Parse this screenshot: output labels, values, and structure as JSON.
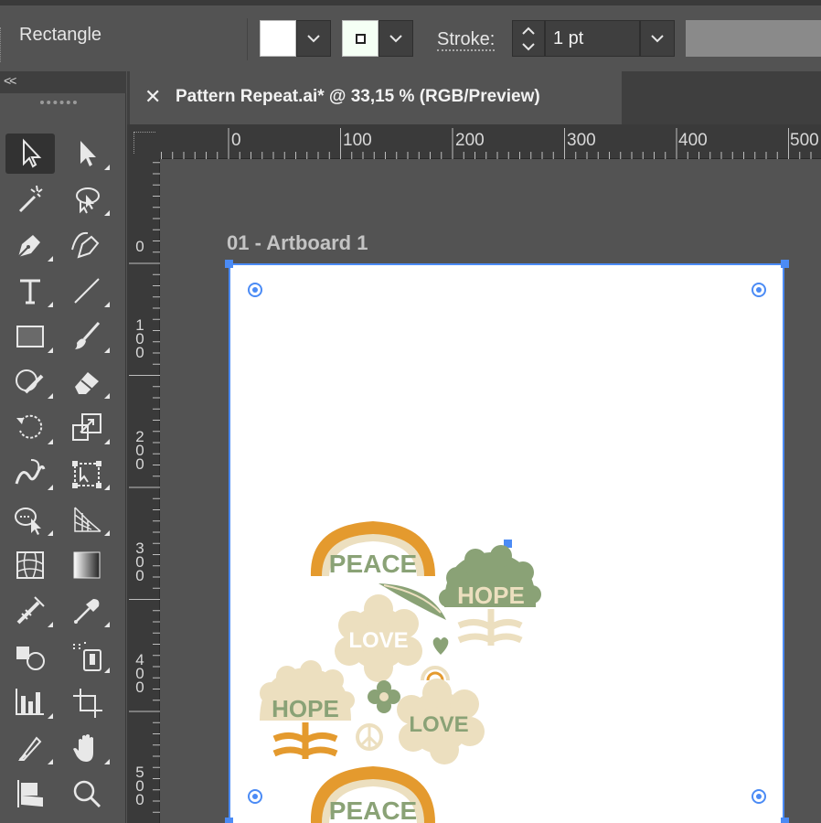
{
  "control_bar": {
    "selection_label": "Rectangle",
    "stroke_label": "Stroke:",
    "stroke_weight": "1 pt",
    "fill_color": "#ffffff"
  },
  "document": {
    "tab_close": "✕",
    "tab_title": "Pattern Repeat.ai* @ 33,15 % (RGB/Preview)"
  },
  "toolbar": {
    "collapse": "<<",
    "tools": [
      "selection-tool",
      "direct-selection-tool",
      "magic-wand-tool",
      "lasso-tool",
      "pen-tool",
      "curvature-tool",
      "type-tool",
      "line-segment-tool",
      "rectangle-tool",
      "paintbrush-tool",
      "shaper-tool",
      "eraser-tool",
      "rotate-tool",
      "scale-tool",
      "warp-tool",
      "free-transform-tool",
      "shape-builder-tool",
      "perspective-grid-tool",
      "mesh-tool",
      "gradient-tool",
      "eyedropper-tool",
      "measure-tool",
      "blend-tool",
      "symbol-sprayer-tool",
      "column-graph-tool",
      "artboard-tool",
      "slice-tool",
      "hand-tool",
      "toggle-tool",
      "zoom-tool"
    ]
  },
  "ruler": {
    "horizontal": [
      "0",
      "100",
      "200",
      "300",
      "400",
      "500"
    ],
    "vertical": [
      "0",
      "1\n0\n0",
      "2\n0\n0",
      "3\n0\n0",
      "4\n0\n0",
      "5\n0\n0"
    ]
  },
  "artboard": {
    "label": "01 - Artboard 1"
  },
  "artwork": {
    "words": [
      "PEACE",
      "HOPE",
      "LOVE",
      "HOPE",
      "LOVE",
      "PEACE"
    ],
    "colors": {
      "orange": "#e49a2e",
      "sage": "#8aa276",
      "cream": "#ecdfbf",
      "accent": "#4b8bf5"
    }
  }
}
